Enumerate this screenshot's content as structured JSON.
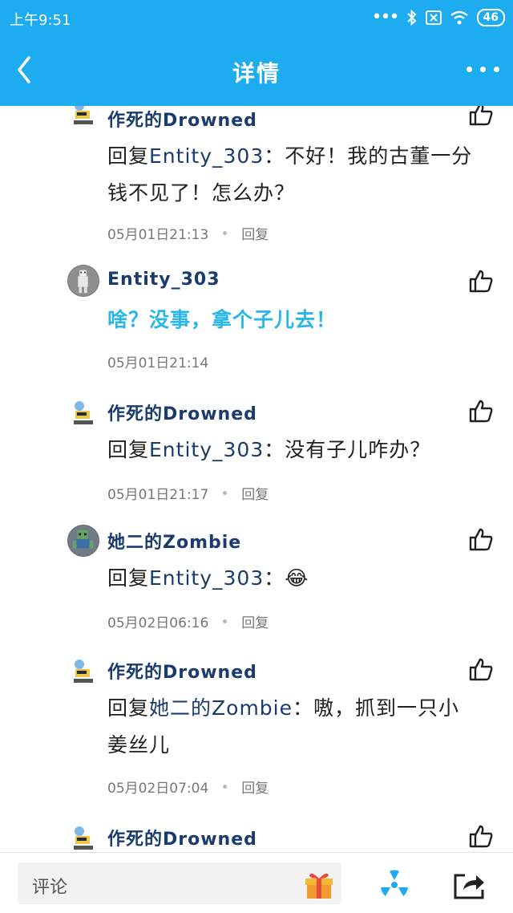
{
  "status_bar": {
    "time": "上午9:51",
    "battery": "46"
  },
  "header": {
    "title": "详情"
  },
  "comments": [
    {
      "username": "作死的Drowned",
      "reply_prefix": "回复",
      "reply_target": "Entity_303",
      "text_line1": "：不好！我的古董一分",
      "text_line2": "钱不见了！怎么办？",
      "time": "05月01日21:13",
      "reply_label": "回复"
    },
    {
      "username": "Entity_303",
      "text": "啥？没事，拿个子儿去！",
      "time": "05月01日21:14"
    },
    {
      "username": "作死的Drowned",
      "reply_prefix": "回复",
      "reply_target": "Entity_303",
      "text": "：没有子儿咋办？",
      "time": "05月01日21:17",
      "reply_label": "回复"
    },
    {
      "username": "她二的Zombie",
      "reply_prefix": "回复",
      "reply_target": "Entity_303",
      "text": "：",
      "emoji": "😂",
      "time": "05月02日06:16",
      "reply_label": "回复"
    },
    {
      "username": "作死的Drowned",
      "reply_prefix": "回复",
      "reply_target": "她二的Zombie",
      "text_line1": "：嗷，抓到一只小",
      "text_line2": "姜丝儿",
      "time": "05月02日07:04",
      "reply_label": "回复"
    },
    {
      "username": "作死的Drowned"
    }
  ],
  "bottom_bar": {
    "comment_placeholder": "评论"
  },
  "colors": {
    "accent": "#1dacef",
    "username": "#1a3b6e",
    "highlight_text": "#29b6e8"
  },
  "icons": [
    "back-arrow-icon",
    "more-icon",
    "like-icon",
    "gift-icon",
    "radiation-icon",
    "share-icon"
  ]
}
